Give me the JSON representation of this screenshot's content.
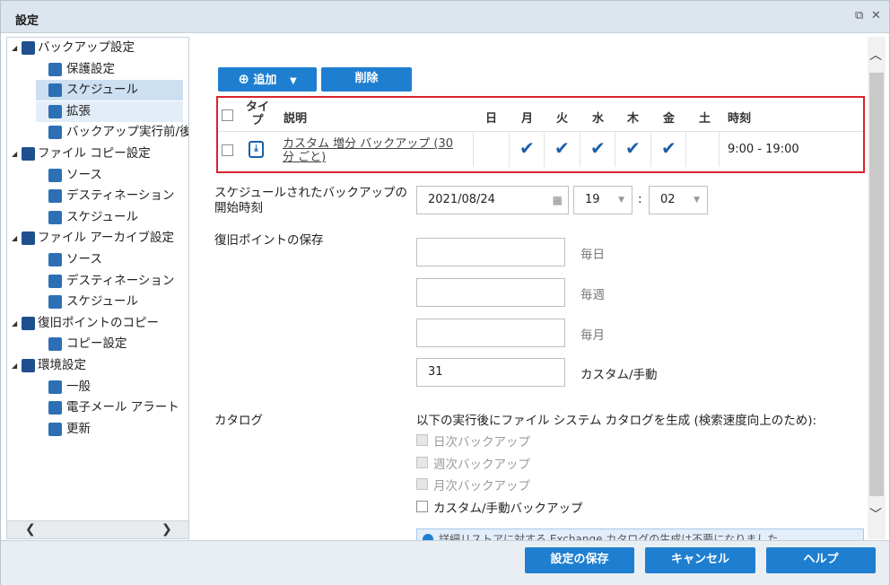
{
  "window": {
    "title": "設定"
  },
  "sidebar": {
    "items": [
      {
        "label": "バックアップ設定",
        "level": 0,
        "icon": "backup-settings-icon"
      },
      {
        "label": "保護設定",
        "level": 1,
        "icon": "protection-icon"
      },
      {
        "label": "スケジュール",
        "level": 1,
        "icon": "schedule-icon",
        "selected": true
      },
      {
        "label": "拡張",
        "level": 1,
        "icon": "advanced-icon",
        "hovered": true
      },
      {
        "label": "バックアップ実行前/後の",
        "level": 1,
        "icon": "pre-post-icon"
      },
      {
        "label": "ファイル コピー設定",
        "level": 0,
        "icon": "file-copy-icon"
      },
      {
        "label": "ソース",
        "level": 1,
        "icon": "source-icon"
      },
      {
        "label": "デスティネーション",
        "level": 1,
        "icon": "destination-icon"
      },
      {
        "label": "スケジュール",
        "level": 1,
        "icon": "schedule-icon"
      },
      {
        "label": "ファイル アーカイブ設定",
        "level": 0,
        "icon": "file-archive-icon"
      },
      {
        "label": "ソース",
        "level": 1,
        "icon": "source-icon"
      },
      {
        "label": "デスティネーション",
        "level": 1,
        "icon": "destination-icon"
      },
      {
        "label": "スケジュール",
        "level": 1,
        "icon": "schedule-icon"
      },
      {
        "label": "復旧ポイントのコピー",
        "level": 0,
        "icon": "recovery-copy-icon"
      },
      {
        "label": "コピー設定",
        "level": 1,
        "icon": "copy-settings-icon"
      },
      {
        "label": "環境設定",
        "level": 0,
        "icon": "preferences-icon"
      },
      {
        "label": "一般",
        "level": 1,
        "icon": "general-icon"
      },
      {
        "label": "電子メール アラート",
        "level": 1,
        "icon": "email-icon"
      },
      {
        "label": "更新",
        "level": 1,
        "icon": "update-icon"
      }
    ]
  },
  "toolbar": {
    "add_label": "追加",
    "delete_label": "削除"
  },
  "grid": {
    "headers": {
      "type": "タイプ",
      "desc": "説明",
      "sun": "日",
      "mon": "月",
      "tue": "火",
      "wed": "水",
      "thu": "木",
      "fri": "金",
      "sat": "土",
      "time": "時刻"
    },
    "rows": [
      {
        "desc": "カスタム 増分 バックアップ (30 分 ごと)",
        "days": [
          false,
          true,
          true,
          true,
          true,
          true,
          false
        ],
        "time": "9:00 - 19:00"
      }
    ]
  },
  "start": {
    "label": "スケジュールされたバックアップの開始時刻",
    "date": "2021/08/24",
    "hour": "19",
    "minute": "02",
    "colon": ":"
  },
  "retention": {
    "label": "復旧ポイントの保存",
    "daily_label": "毎日",
    "weekly_label": "毎週",
    "monthly_label": "毎月",
    "custom_label": "カスタム/手動",
    "daily": "",
    "weekly": "",
    "monthly": "",
    "custom": "31"
  },
  "catalog": {
    "label": "カタログ",
    "desc": "以下の実行後にファイル システム カタログを生成 (検索速度向上のため):",
    "options": [
      {
        "label": "日次バックアップ",
        "disabled": true,
        "checked": false
      },
      {
        "label": "週次バックアップ",
        "disabled": true,
        "checked": false
      },
      {
        "label": "月次バックアップ",
        "disabled": true,
        "checked": false
      },
      {
        "label": "カスタム/手動バックアップ",
        "disabled": false,
        "checked": false
      }
    ],
    "info": "詳細リストアに対する Exchange カタログの生成は不要になりました"
  },
  "footer": {
    "save_label": "設定の保存",
    "cancel_label": "キャンセル",
    "help_label": "ヘルプ"
  }
}
